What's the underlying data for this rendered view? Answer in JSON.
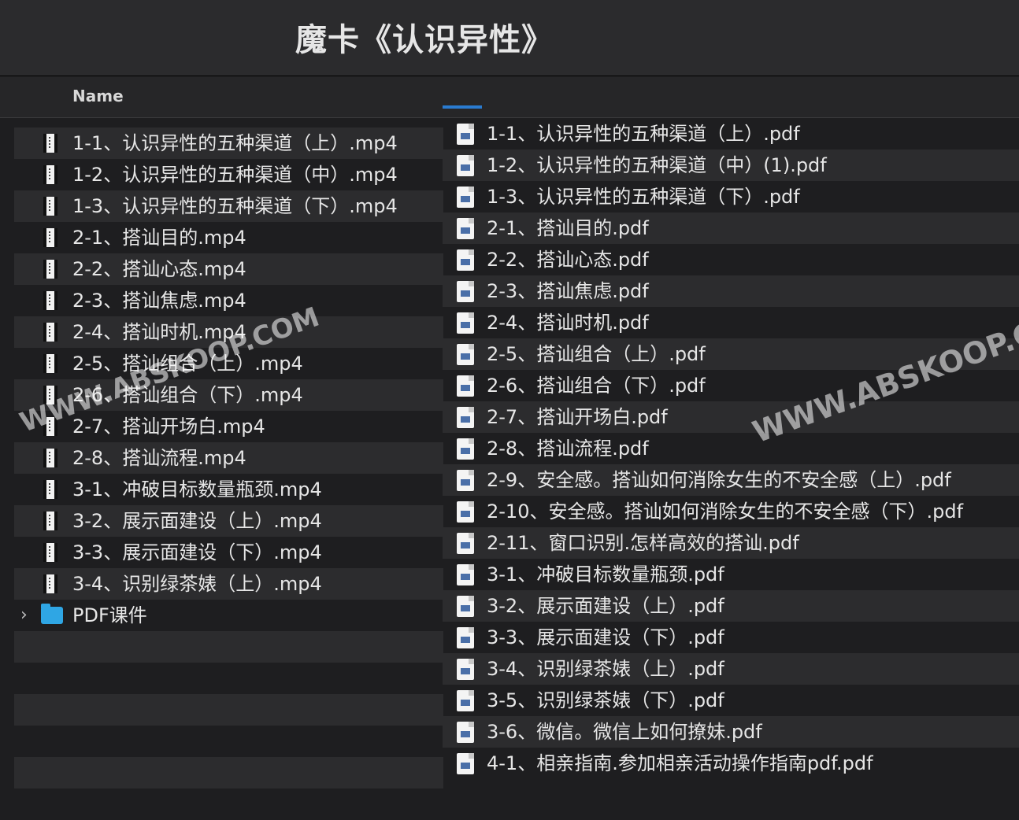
{
  "window": {
    "title": "魔卡《认识异性》"
  },
  "header": {
    "name_column": "Name"
  },
  "watermarks": [
    "WWW.ABSKOOP.COM",
    "WWW.ABSKOOP.C"
  ],
  "left_files": [
    "1-1、认识异性的五种渠道（上）.mp4",
    "1-2、认识异性的五种渠道（中）.mp4",
    "1-3、认识异性的五种渠道（下）.mp4",
    "2-1、搭讪目的.mp4",
    "2-2、搭讪心态.mp4",
    "2-3、搭讪焦虑.mp4",
    "2-4、搭讪时机.mp4",
    "2-5、搭讪组合（上）.mp4",
    "2-6、搭讪组合（下）.mp4",
    "2-7、搭讪开场白.mp4",
    "2-8、搭讪流程.mp4",
    "3-1、冲破目标数量瓶颈.mp4",
    "3-2、展示面建设（上）.mp4",
    "3-3、展示面建设（下）.mp4",
    "3-4、识别绿茶婊（上）.mp4"
  ],
  "folder": {
    "name": "PDF课件",
    "chevron": "›"
  },
  "right_files": [
    "1-1、认识异性的五种渠道（上）.pdf",
    "1-2、认识异性的五种渠道（中）(1).pdf",
    "1-3、认识异性的五种渠道（下）.pdf",
    "2-1、搭讪目的.pdf",
    "2-2、搭讪心态.pdf",
    "2-3、搭讪焦虑.pdf",
    "2-4、搭讪时机.pdf",
    "2-5、搭讪组合（上）.pdf",
    "2-6、搭讪组合（下）.pdf",
    "2-7、搭讪开场白.pdf",
    "2-8、搭讪流程.pdf",
    "2-9、安全感。搭讪如何消除女生的不安全感（上）.pdf",
    "2-10、安全感。搭讪如何消除女生的不安全感（下）.pdf",
    "2-11、窗口识别.怎样高效的搭讪.pdf",
    "3-1、冲破目标数量瓶颈.pdf",
    "3-2、展示面建设（上）.pdf",
    "3-3、展示面建设（下）.pdf",
    "3-4、识别绿茶婊（上）.pdf",
    "3-5、识别绿茶婊（下）.pdf",
    "3-6、微信。微信上如何撩妹.pdf",
    "4-1、相亲指南.参加相亲活动操作指南pdf.pdf"
  ]
}
